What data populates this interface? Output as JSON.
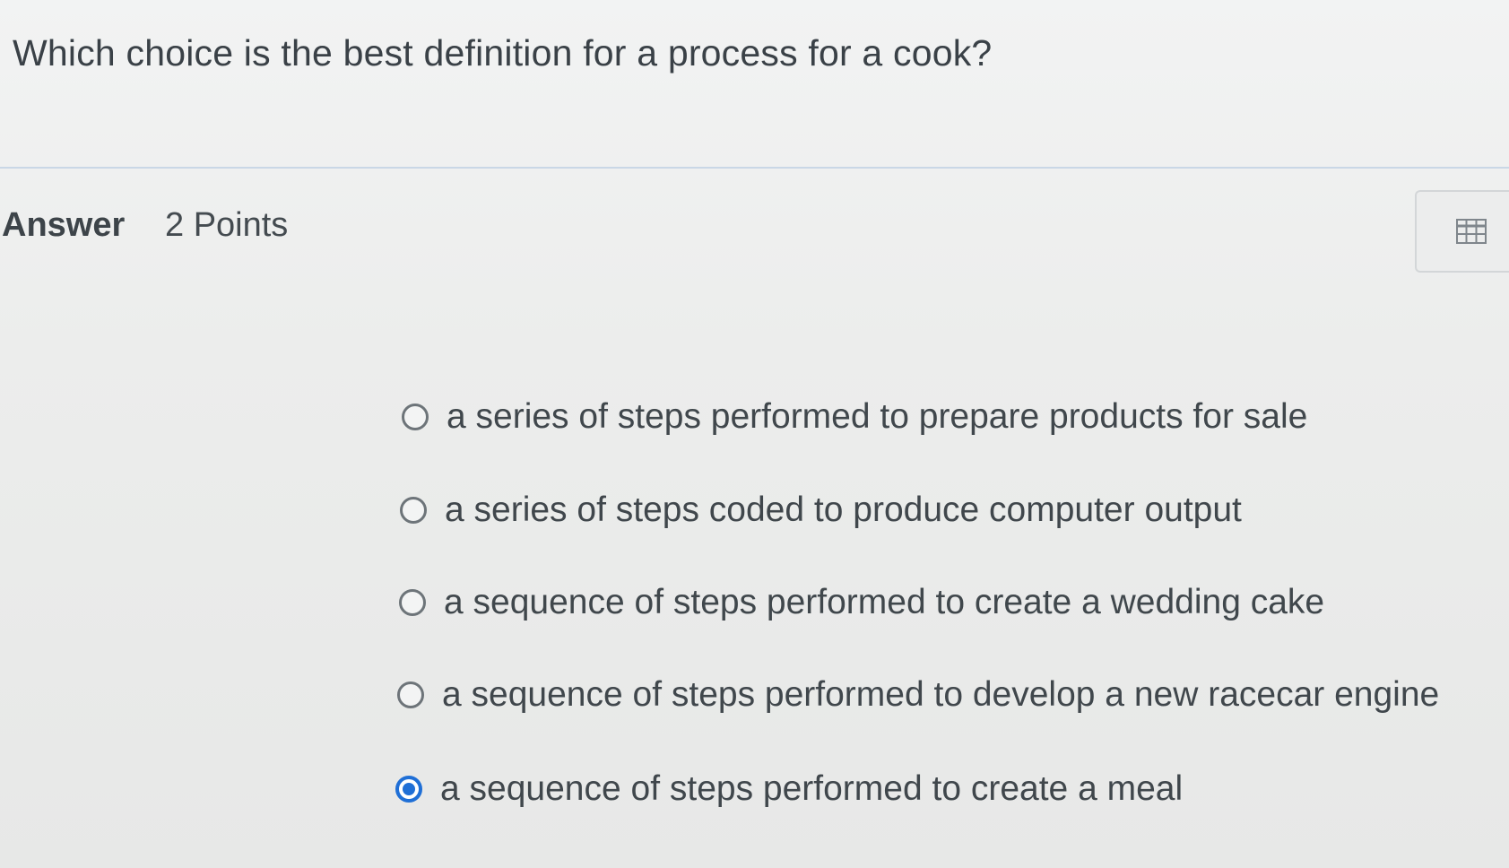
{
  "question": {
    "text": "Which choice is the best definition for a process for a cook?"
  },
  "answer": {
    "label": "Answer",
    "points": "2 Points"
  },
  "toolbar": {
    "icon": "table-icon"
  },
  "options": [
    {
      "label": "a series of steps performed to prepare products for sale",
      "selected": false
    },
    {
      "label": "a series of steps coded to produce computer output",
      "selected": false
    },
    {
      "label": "a sequence of steps performed to create a wedding cake",
      "selected": false
    },
    {
      "label": "a sequence of steps performed to develop a new racecar engine",
      "selected": false
    },
    {
      "label": "a sequence of steps performed to create a meal",
      "selected": true
    }
  ],
  "colors": {
    "accent": "#1f6fd6",
    "divider": "#c9d7e6"
  }
}
